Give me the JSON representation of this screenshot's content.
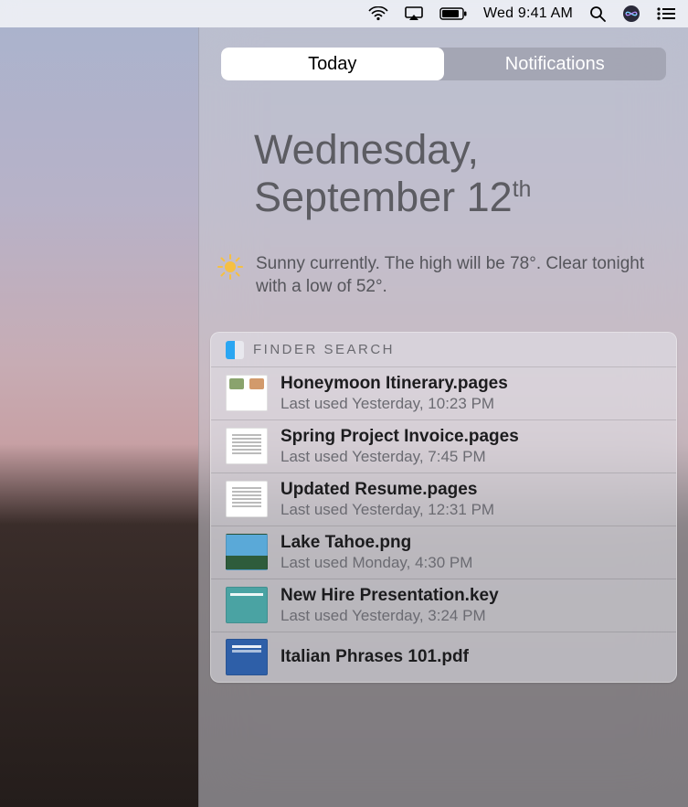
{
  "menubar": {
    "clock": "Wed 9:41 AM"
  },
  "nc": {
    "tabs": {
      "today": "Today",
      "notifications": "Notifications",
      "active": "today"
    },
    "date": {
      "weekday": "Wednesday,",
      "month_day": "September 12",
      "ordinal": "th"
    },
    "weather": {
      "summary": "Sunny currently. The high will be 78°.  Clear tonight with a low of 52°."
    },
    "finder": {
      "title": "FINDER SEARCH",
      "items": [
        {
          "name": "Honeymoon Itinerary.pages",
          "sub": "Last used Yesterday, 10:23 PM",
          "thumb": "honeymoon"
        },
        {
          "name": "Spring Project Invoice.pages",
          "sub": "Last used Yesterday, 7:45 PM",
          "thumb": "doc"
        },
        {
          "name": "Updated Resume.pages",
          "sub": "Last used Yesterday, 12:31 PM",
          "thumb": "doc"
        },
        {
          "name": "Lake Tahoe.png",
          "sub": "Last used Monday, 4:30 PM",
          "thumb": "photo"
        },
        {
          "name": "New Hire Presentation.key",
          "sub": "Last used Yesterday, 3:24 PM",
          "thumb": "key"
        },
        {
          "name": "Italian Phrases 101.pdf",
          "sub": "",
          "thumb": "pdf"
        }
      ]
    }
  }
}
